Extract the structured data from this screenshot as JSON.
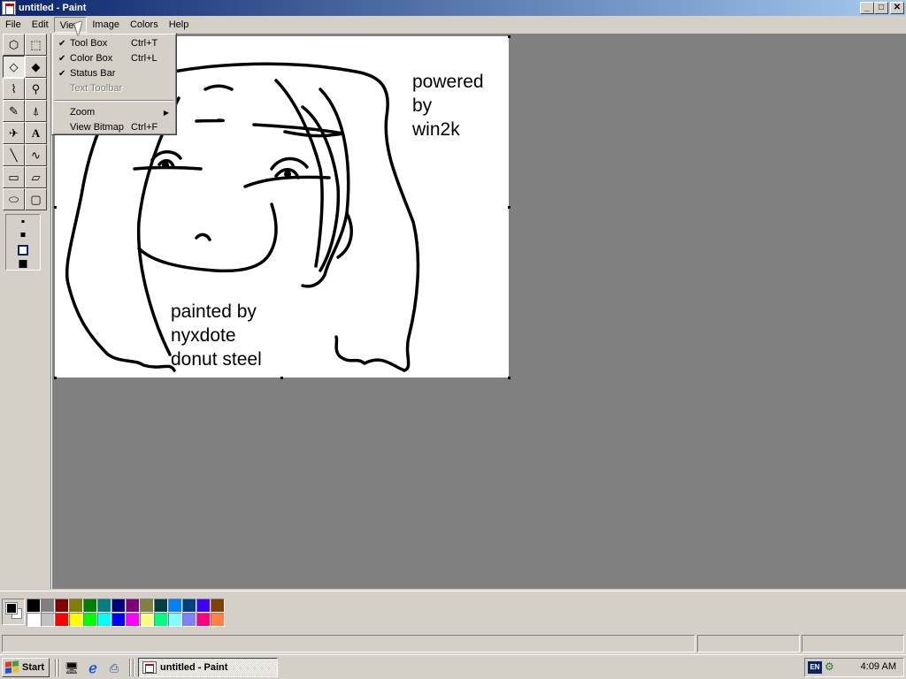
{
  "window": {
    "title": "untitled - Paint",
    "btn_min": "_",
    "btn_max": "□",
    "btn_close": "✕"
  },
  "menubar": [
    "File",
    "Edit",
    "View",
    "Image",
    "Colors",
    "Help"
  ],
  "view_menu": {
    "items": [
      {
        "label": "Tool Box",
        "shortcut": "Ctrl+T",
        "checked": "✔"
      },
      {
        "label": "Color Box",
        "shortcut": "Ctrl+L",
        "checked": "✔"
      },
      {
        "label": "Status Bar",
        "shortcut": "",
        "checked": "✔"
      },
      {
        "label": "Text Toolbar",
        "shortcut": "",
        "checked": ""
      },
      {
        "label": "Zoom",
        "arrow": "▶"
      },
      {
        "label": "View Bitmap",
        "shortcut": "Ctrl+F"
      }
    ]
  },
  "tools": {
    "free_select": "⬡",
    "rect_select": "⬚",
    "eraser": "◇",
    "fill": "◆",
    "picker": "⌇",
    "magnifier": "⚲",
    "pencil": "✎",
    "brush": "⍋",
    "airbrush": "✈",
    "text": "A",
    "line": "╲",
    "curve": "∿",
    "rectangle": "▭",
    "polygon": "▱",
    "ellipse": "⬭",
    "rounded_rect": "▢"
  },
  "canvas_text": {
    "powered": [
      "powered",
      "by",
      "win2k"
    ],
    "painted": [
      "painted by",
      "nyxdote",
      "donut steel"
    ]
  },
  "palette": {
    "colors": [
      "#000000",
      "#808080",
      "#800000",
      "#808000",
      "#008000",
      "#008080",
      "#000080",
      "#800080",
      "#808040",
      "#004040",
      "#0080ff",
      "#004080",
      "#4000ff",
      "#804000",
      "#ffffff",
      "#c0c0c0",
      "#ff0000",
      "#ffff00",
      "#00ff00",
      "#00ffff",
      "#0000ff",
      "#ff00ff",
      "#ffff80",
      "#00ff80",
      "#80ffff",
      "#8080ff",
      "#ff0080",
      "#ff8040"
    ],
    "foreground": "#000000",
    "background": "#ffffff"
  },
  "taskbar": {
    "start_label": "Start",
    "task_label": "untitled - Paint",
    "lang": "EN",
    "clock": "4:09 AM",
    "quick_launch": {
      "desktop": "🖥",
      "ie": "ℯ",
      "channels": "⎙"
    },
    "tray_icon": "⚙"
  }
}
